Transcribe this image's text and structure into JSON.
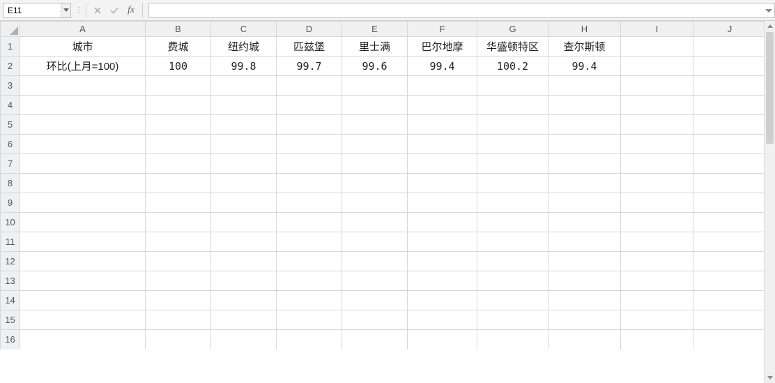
{
  "formula_bar": {
    "name_box_value": "E11",
    "cancel_title": "Cancel",
    "enter_title": "Enter",
    "fx_label": "fx",
    "formula_value": ""
  },
  "columns": [
    "A",
    "B",
    "C",
    "D",
    "E",
    "F",
    "G",
    "H",
    "I",
    "J"
  ],
  "column_widths": [
    "wA",
    "wB",
    "wC",
    "wD",
    "wE",
    "wF",
    "wG",
    "wH",
    "wI",
    "wJ"
  ],
  "row_count": 16,
  "cells": {
    "1": {
      "A": "城市",
      "B": "费城",
      "C": "纽约城",
      "D": "匹兹堡",
      "E": "里士满",
      "F": "巴尔地摩",
      "G": "华盛顿特区",
      "H": "查尔斯顿"
    },
    "2": {
      "A": "环比(上月=100)",
      "B": "100",
      "C": "99.8",
      "D": "99.7",
      "E": "99.6",
      "F": "99.4",
      "G": "100.2",
      "H": "99.4"
    }
  },
  "chart_data": {
    "type": "table",
    "title": "",
    "columns": [
      "城市",
      "费城",
      "纽约城",
      "匹兹堡",
      "里士满",
      "巴尔地摩",
      "华盛顿特区",
      "查尔斯顿"
    ],
    "rows": [
      {
        "label": "环比(上月=100)",
        "values": [
          100,
          99.8,
          99.7,
          99.6,
          99.4,
          100.2,
          99.4
        ]
      }
    ]
  }
}
